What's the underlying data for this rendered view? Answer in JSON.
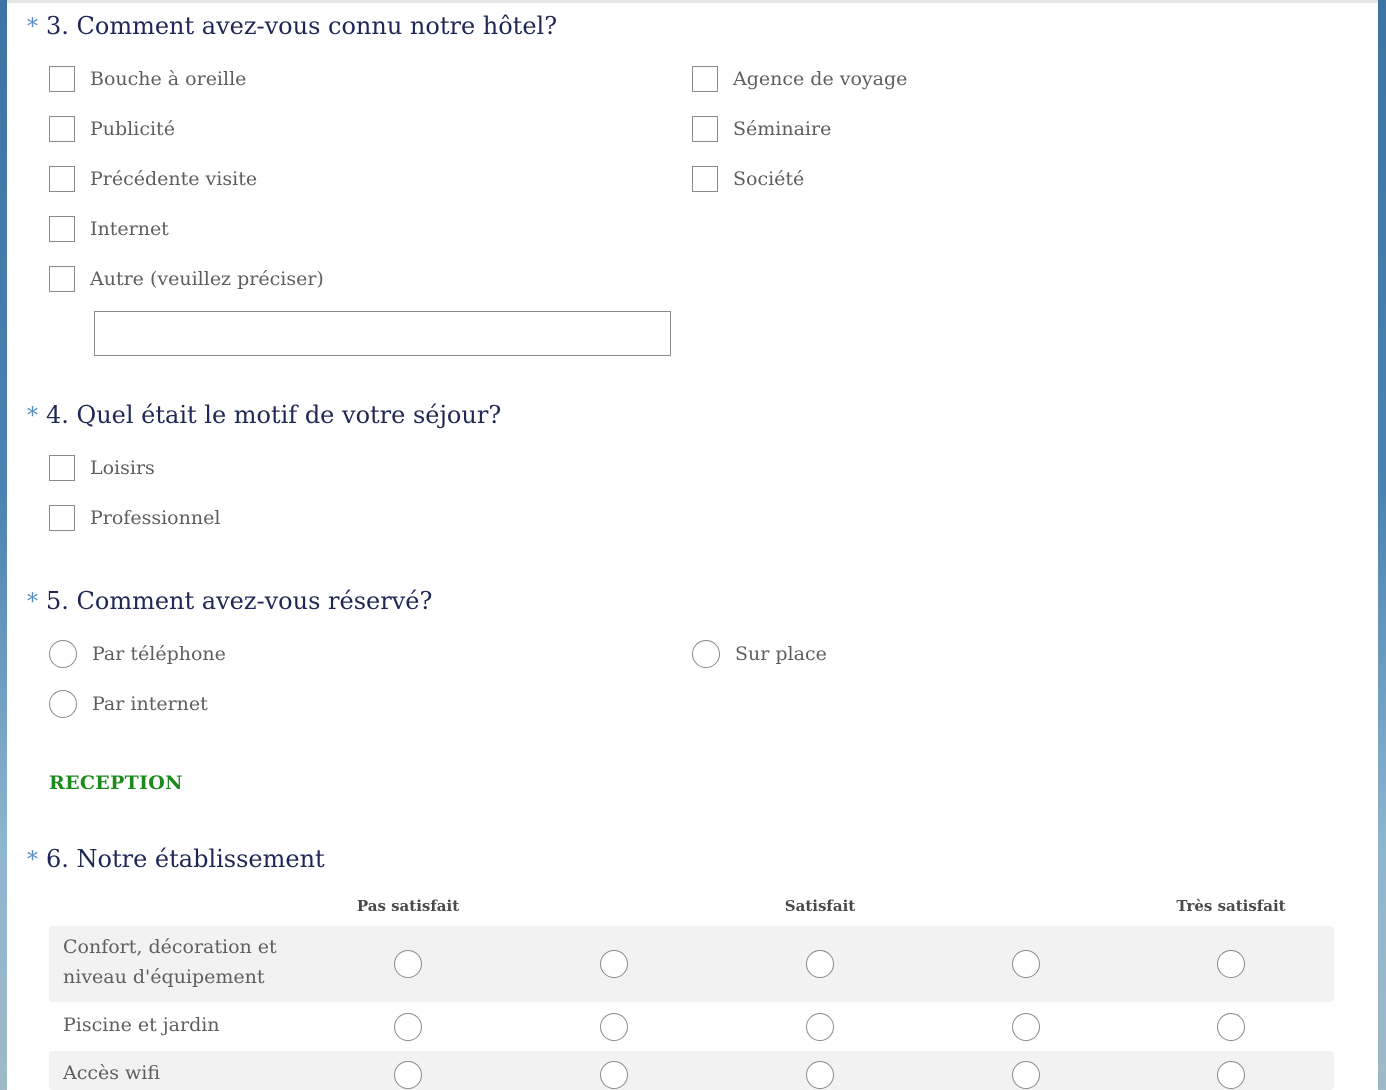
{
  "questions": {
    "q3": {
      "required_mark": "*",
      "title": "3. Comment avez-vous connu notre hôtel?",
      "options_col1": [
        "Bouche à oreille",
        "Publicité",
        "Précédente visite",
        "Internet",
        "Autre (veuillez préciser)"
      ],
      "options_col2": [
        "Agence de voyage",
        "Séminaire",
        "Société"
      ],
      "other_input_value": ""
    },
    "q4": {
      "required_mark": "*",
      "title": "4. Quel était le motif de votre séjour?",
      "options": [
        "Loisirs",
        "Professionnel"
      ]
    },
    "q5": {
      "required_mark": "*",
      "title": "5. Comment avez-vous réservé?",
      "options_col1": [
        "Par téléphone",
        "Par internet"
      ],
      "options_col2": [
        "Sur place"
      ]
    },
    "section": "RECEPTION",
    "q6": {
      "required_mark": "*",
      "title": "6. Notre établissement",
      "column_headers": [
        "Pas satisfait",
        "Satisfait",
        "Très satisfait"
      ],
      "rows": [
        {
          "label_line1": "Confort, décoration et",
          "label_line2": "niveau d'équipement"
        },
        {
          "label_line1": "Piscine et jardin"
        },
        {
          "label_line1": "Accès wifi"
        }
      ]
    }
  },
  "colors": {
    "question_text": "#1e2755",
    "required_star": "#5a8fc2",
    "section_heading": "#1c8a1c",
    "option_text": "#5e5e5e",
    "row_shade": "#f2f2f2"
  }
}
